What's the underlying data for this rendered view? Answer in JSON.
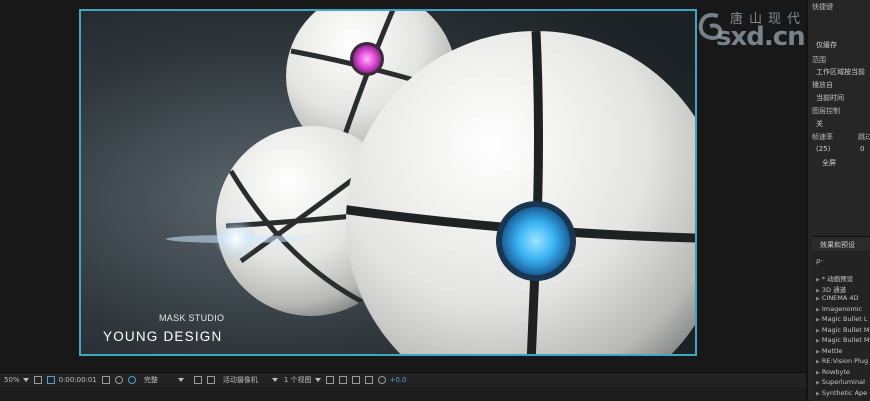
{
  "composition": {
    "studio_label": "MASK STUDIO",
    "title": "YOUNG DESIGN",
    "frame_color": "#3fa7c4",
    "orb_colors": {
      "pink": "#e04ad8",
      "blue": "#3fb3f0"
    }
  },
  "viewer_toolbar": {
    "zoom": "50%",
    "timecode": "0:00:00:01",
    "resolution": "完整",
    "camera": "活动摄像机",
    "views": "1 个视图",
    "exposure": "+0.0"
  },
  "right_panel": {
    "label_preview": "快捷键",
    "value_preview": "仅缓存",
    "label_range": "范围",
    "value_range": "工作区域按当前",
    "label_play_from": "播放自",
    "value_play_from": "当前时间",
    "label_frame_rate_control": "帧速率",
    "label_skip": "跳过",
    "value_frame_rate": "(25)",
    "value_skip": "0",
    "label_fullscreen": "全屏",
    "label_image_control": "图层控制",
    "value_image_control": "关"
  },
  "effects_panel": {
    "title": "效果和预设",
    "search_placeholder": "ρ-",
    "items": [
      "* 动画预设",
      "3D 通道",
      "CINEMA 4D",
      "Imagenomic",
      "Magic Bullet L",
      "Magic Bullet M",
      "Magic Bullet M",
      "Mettle",
      "RE:Vision Plug",
      "Rowbyte",
      "Superluminal",
      "Synthetic Ape"
    ]
  },
  "watermark": {
    "cn": "唐山现代",
    "en": "sxd.cn"
  }
}
